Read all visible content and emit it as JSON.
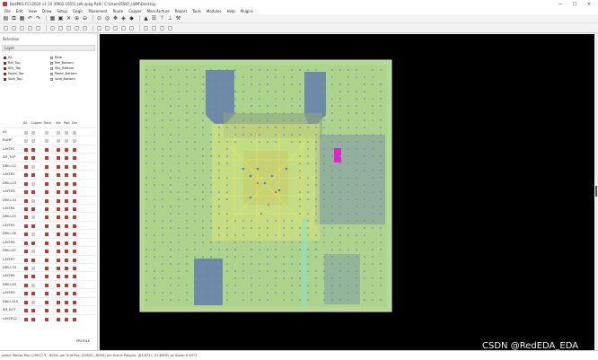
{
  "window": {
    "title": "RedPKG FCv2024 v1.10 (0902-1655) zeb.zpkg    Path: C:\\Users\\SSKY_LWM\\Desktop",
    "controls": [
      "—",
      "☐",
      "✕"
    ]
  },
  "menu": [
    "File",
    "Edit",
    "View",
    "Draw",
    "Setup",
    "Gogic",
    "Placement",
    "Route",
    "Copper",
    "Manufacture",
    "Report",
    "Tools",
    "Modules",
    "Help",
    "Plugins"
  ],
  "left_panel": {
    "title": "Selection",
    "header": "Layer",
    "flags": [
      {
        "label": "All",
        "on": true
      },
      {
        "label": "Blde",
        "on": false
      },
      {
        "label": "Ref_Top",
        "on": true
      },
      {
        "label": "Ref_Bottom",
        "on": false
      },
      {
        "label": "Slik_Top",
        "on": true
      },
      {
        "label": "Slik_Bottom",
        "on": false
      },
      {
        "label": "Paste_Top",
        "on": true
      },
      {
        "label": "Paste_Bottom",
        "on": false
      },
      {
        "label": "Sold_Top",
        "on": true
      },
      {
        "label": "Sold_Bottom",
        "on": false
      }
    ],
    "columns": [
      "All",
      "Copper",
      "Track",
      "Via",
      "Pad",
      "Drc"
    ],
    "layers": [
      "All",
      "BUMP",
      "LAYER1",
      "SM_TOP",
      "DRILL12",
      "LAYER2",
      "DRILL23",
      "LAYER3",
      "DRILL34",
      "LAYER4",
      "DRILL45",
      "LAYER5",
      "DRILL56",
      "LAYER6",
      "DRILL67",
      "LAYER7",
      "DRILL78",
      "LAYER8",
      "DRILL89",
      "LAYER9",
      "DRILL910",
      "SM_BOT",
      "LAYER10"
    ],
    "profile_label": "PROFILE",
    "profile_all": "All"
  },
  "status": {
    "text": "select  Mouse Pos: (29517.5, -8054) μm Grid Pos: (29500, -8050) μm Scene Pos(px): (83.6717, 22.8302) px Scale: 8.4971"
  },
  "watermark": "CSDN @RedEDA_EDA",
  "colors": {
    "board": "#b4d98f",
    "copper": "#6d8aa8",
    "trace": "#e8e85a",
    "pad": "#e026c8",
    "accent": "#c0392b",
    "canvas": "#000000"
  },
  "toolbar_icons_row1": [
    "save-icon",
    "copy-icon",
    "paste-icon",
    "undo-icon",
    "redo-icon",
    "grid-icon",
    "fit-icon",
    "delete-icon",
    "zoom-in-icon",
    "zoom-out-icon",
    "zoom-area-icon",
    "zoom-fit-icon",
    "pan-icon",
    "layer-icon",
    "3d-icon",
    "drc-icon",
    "report-icon",
    "align-icon",
    "distribute-icon",
    "tool-icon"
  ],
  "toolbar_icons_row2": [
    "line-icon",
    "circle-icon",
    "rect-icon",
    "text-icon",
    "via-icon",
    "pad-icon",
    "poly-icon",
    "route-icon",
    "diff-icon",
    "tune-icon",
    "copper-icon",
    "cut-icon",
    "measure-icon",
    "info-icon",
    "bus-icon",
    "trace-icon",
    "ruler-icon",
    "eye-icon",
    "grid2-icon"
  ]
}
